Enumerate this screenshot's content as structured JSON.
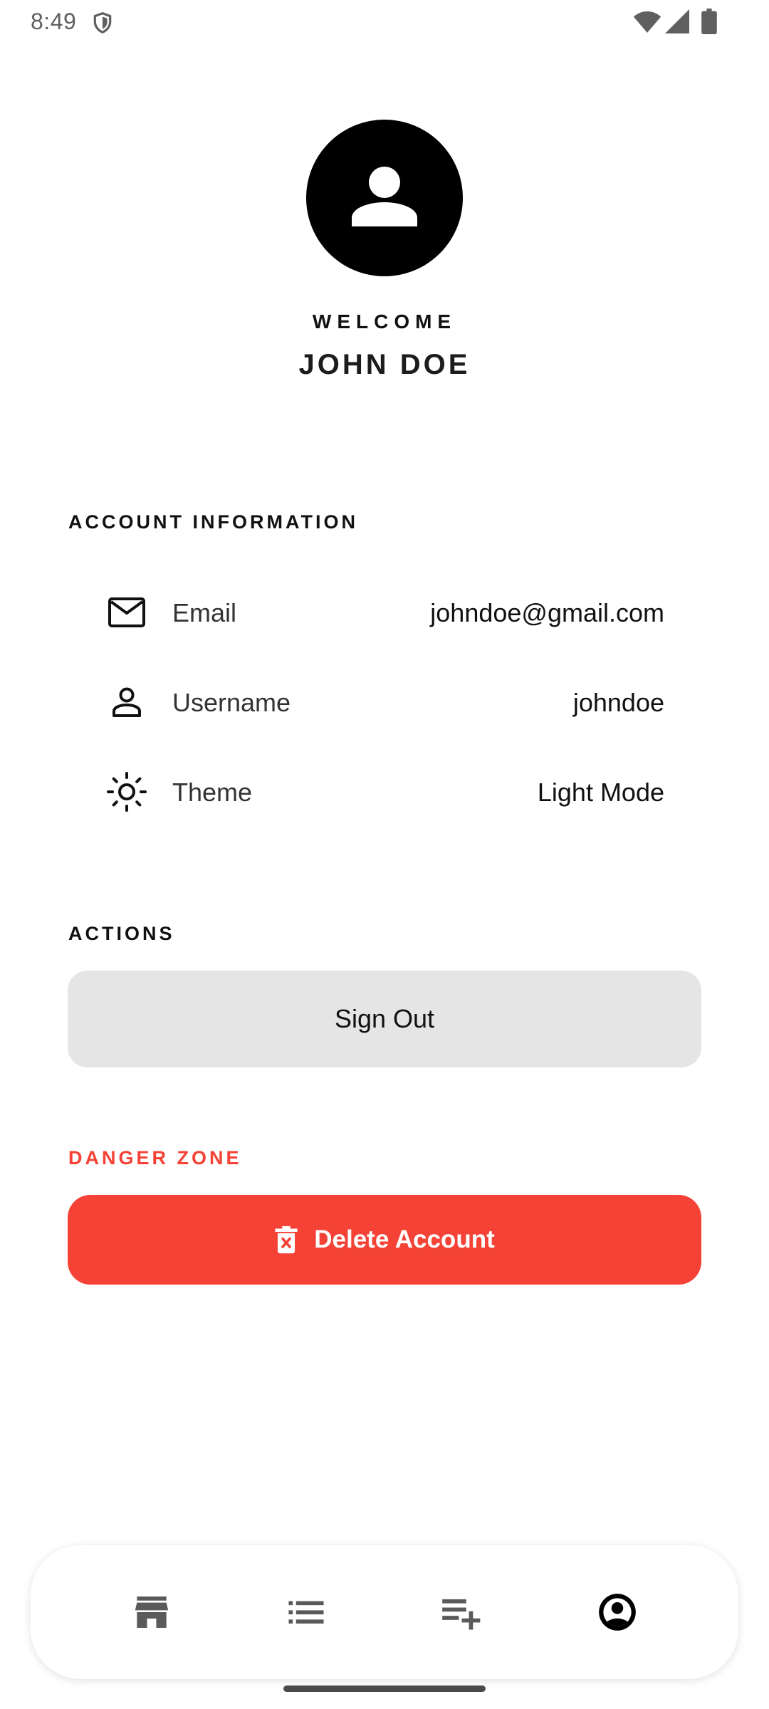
{
  "status_bar": {
    "time": "8:49"
  },
  "profile": {
    "welcome": "WELCOME",
    "name": "JOHN DOE"
  },
  "account_info": {
    "header": "ACCOUNT INFORMATION",
    "rows": [
      {
        "icon": "mail-icon",
        "label": "Email",
        "value": "johndoe@gmail.com"
      },
      {
        "icon": "person-icon",
        "label": "Username",
        "value": "johndoe"
      },
      {
        "icon": "sun-icon",
        "label": "Theme",
        "value": "Light Mode"
      }
    ]
  },
  "actions": {
    "header": "ACTIONS",
    "sign_out_label": "Sign Out"
  },
  "danger_zone": {
    "header": "DANGER ZONE",
    "delete_label": "Delete Account",
    "color": "#f44336"
  },
  "bottom_nav": {
    "items": [
      {
        "icon": "store-icon",
        "active": false
      },
      {
        "icon": "list-icon",
        "active": false
      },
      {
        "icon": "playlist-add-icon",
        "active": false
      },
      {
        "icon": "account-circle-icon",
        "active": true
      }
    ]
  }
}
